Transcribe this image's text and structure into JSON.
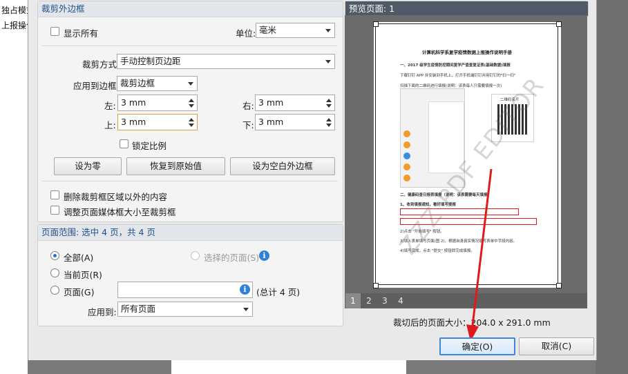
{
  "background": {
    "left_text_1": "独占模式",
    "left_text_2": "上报操作"
  },
  "crop_margins": {
    "header": "裁剪外边框",
    "show_all_label": "显示所有",
    "unit_label": "单位:",
    "unit_value": "毫米",
    "crop_method_label": "裁剪方式",
    "crop_method_value": "手动控制页边距",
    "apply_to_box_label": "应用到边框",
    "apply_to_box_value": "裁剪边框",
    "left_label": "左:",
    "left_value": "3 mm",
    "right_label": "右:",
    "right_value": "3 mm",
    "top_label": "上:",
    "top_value": "3 mm",
    "bottom_label": "下:",
    "bottom_value": "3 mm",
    "lock_ratio_label": "锁定比例",
    "set_zero_label": "设为零",
    "revert_label": "恢复到原始值",
    "set_white_margins_label": "设为空白外边框",
    "delete_outside_label": "删除裁剪框区域以外的内容",
    "adjust_media_label": "调整页面媒体框大小至裁剪框"
  },
  "page_range": {
    "header": "页面范围: 选中 4 页，共 4 页",
    "all_label": "全部(A)",
    "selected_pages_label": "选择的页面(S)",
    "current_label": "当前页(R)",
    "pages_label": "页面(G)",
    "pages_value": "",
    "pages_total": "(总计 4 页)",
    "apply_to_label": "应用到:",
    "apply_to_value": "所有页面"
  },
  "preview": {
    "header": "预览页面: 1",
    "page_numbers": [
      "1",
      "2",
      "3",
      "4"
    ],
    "size_text": "裁切后的页面大小：204.0 x 291.0 mm",
    "doc_title": "计算机科学系复学疫情数据上报操作说明手册",
    "doc_section_1": "一、2017 级学生疫情防控期间复学产值查复证表(基础数据)填报",
    "doc_line_1": "下载钉钉 APP 并安装到手机上，打开手机端钉钉并用钉钉的\"扫一扫\"",
    "doc_line_2": "扫描下面的二维码进行填报(说明：该表每人只需要填报一次)",
    "doc_section_2": "二、健康码查日报表填报（说明：该表需要每天填报",
    "doc_line_3": "1、收到填报通知，看好填写提报",
    "doc_line_4": "2)点击 \"开始填写\" 按钮。",
    "doc_line_5": "3)填入表单填写页面(图 2)，根据自身真实情况填写表单中字段内容。",
    "doc_line_6": "4)填写完成，点击 \"提交\" 按钮即完成填报。",
    "qr_caption": "二维码名片",
    "watermark": "ZZZ PDF EDITOR"
  },
  "buttons": {
    "ok_label": "确定(O)",
    "cancel_label": "取消(C)"
  },
  "colors": {
    "accent": "#2f80d8",
    "annotation_red": "#e01a1a"
  }
}
